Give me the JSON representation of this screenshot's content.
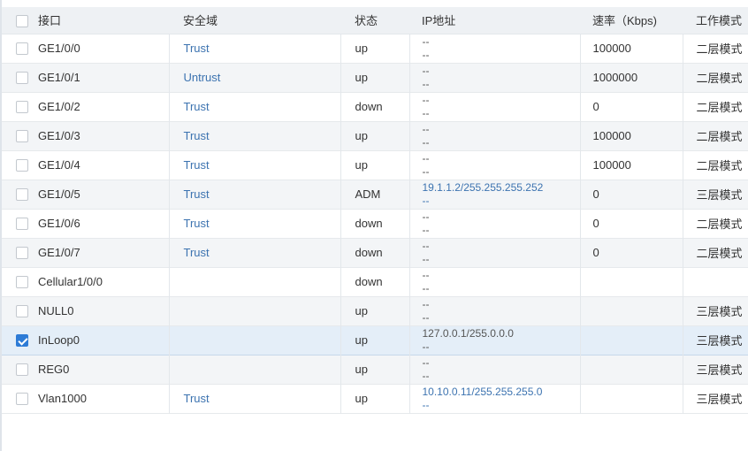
{
  "columns": {
    "name": "接口",
    "zone": "安全域",
    "state": "状态",
    "ip": "IP地址",
    "speed": "速率（Kbps)",
    "mode": "工作模式"
  },
  "rows": [
    {
      "name": "GE1/0/0",
      "zone": "Trust",
      "state": "up",
      "ip1": "--",
      "ip2": "--",
      "speed": "100000",
      "mode": "二层模式",
      "checked": false
    },
    {
      "name": "GE1/0/1",
      "zone": "Untrust",
      "state": "up",
      "ip1": "--",
      "ip2": "--",
      "speed": "1000000",
      "mode": "二层模式",
      "checked": false
    },
    {
      "name": "GE1/0/2",
      "zone": "Trust",
      "state": "down",
      "ip1": "--",
      "ip2": "--",
      "speed": "0",
      "mode": "二层模式",
      "checked": false
    },
    {
      "name": "GE1/0/3",
      "zone": "Trust",
      "state": "up",
      "ip1": "--",
      "ip2": "--",
      "speed": "100000",
      "mode": "二层模式",
      "checked": false
    },
    {
      "name": "GE1/0/4",
      "zone": "Trust",
      "state": "up",
      "ip1": "--",
      "ip2": "--",
      "speed": "100000",
      "mode": "二层模式",
      "checked": false
    },
    {
      "name": "GE1/0/5",
      "zone": "Trust",
      "state": "ADM",
      "ip1": "19.1.1.2/255.255.255.252",
      "ip2": "--",
      "speed": "0",
      "mode": "三层模式",
      "checked": false
    },
    {
      "name": "GE1/0/6",
      "zone": "Trust",
      "state": "down",
      "ip1": "--",
      "ip2": "--",
      "speed": "0",
      "mode": "二层模式",
      "checked": false
    },
    {
      "name": "GE1/0/7",
      "zone": "Trust",
      "state": "down",
      "ip1": "--",
      "ip2": "--",
      "speed": "0",
      "mode": "二层模式",
      "checked": false
    },
    {
      "name": "Cellular1/0/0",
      "zone": "",
      "state": "down",
      "ip1": "--",
      "ip2": "--",
      "speed": "",
      "mode": "",
      "checked": false
    },
    {
      "name": "NULL0",
      "zone": "",
      "state": "up",
      "ip1": "--",
      "ip2": "--",
      "speed": "",
      "mode": "三层模式",
      "checked": false
    },
    {
      "name": "InLoop0",
      "zone": "",
      "state": "up",
      "ip1": "127.0.0.1/255.0.0.0",
      "ip2": "--",
      "speed": "",
      "mode": "三层模式",
      "checked": true
    },
    {
      "name": "REG0",
      "zone": "",
      "state": "up",
      "ip1": "--",
      "ip2": "--",
      "speed": "",
      "mode": "三层模式",
      "checked": false
    },
    {
      "name": "Vlan1000",
      "zone": "Trust",
      "state": "up",
      "ip1": "10.10.0.11/255.255.255.0",
      "ip2": "--",
      "speed": "",
      "mode": "三层模式",
      "checked": false
    }
  ]
}
